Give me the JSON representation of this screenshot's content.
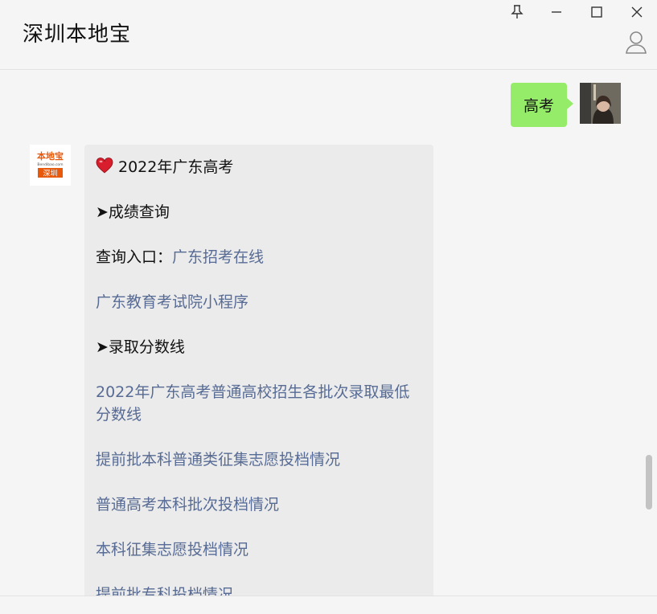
{
  "window": {
    "title": "深圳本地宝",
    "controls": [
      "pin-icon",
      "minimize-icon",
      "maximize-icon",
      "close-icon"
    ]
  },
  "messages": {
    "outgoing": {
      "text": "高考"
    },
    "incoming": {
      "avatar_logo": {
        "top": "本地宝",
        "sub": "Bendibao.com",
        "city": "深圳"
      },
      "heading": "2022年广东高考",
      "section1": "➤成绩查询",
      "query_prefix": "查询入口：",
      "query_link": "广东招考在线",
      "link_mini": "广东教育考试院小程序",
      "section2": "➤录取分数线",
      "link_scores": "2022年广东高考普通高校招生各批次录取最低分数线",
      "link_early_batch": "提前批本科普通类征集志愿投档情况",
      "link_regular_batch": "普通高考本科批次投档情况",
      "link_supplement": "本科征集志愿投档情况",
      "link_partial": "提前批专科投档情况"
    }
  },
  "colors": {
    "link": "#576b95",
    "outgoing_bubble": "#95ec69",
    "incoming_bubble": "#ebebeb",
    "brand_orange": "#e8590c"
  }
}
